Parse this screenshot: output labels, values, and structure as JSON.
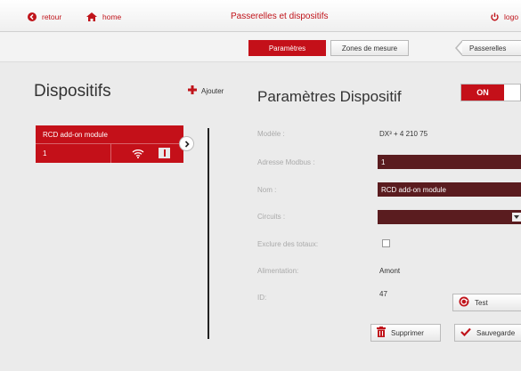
{
  "topbar": {
    "back_label": "retour",
    "home_label": "home",
    "title": "Passerelles et dispositifs",
    "logout_label": "logo"
  },
  "tabs": {
    "active": "Paramètres",
    "zones": "Zones de mesure",
    "passerelles": "Passerelles"
  },
  "left": {
    "title": "Dispositifs",
    "add_label": "Ajouter",
    "device": {
      "name": "RCD add-on module",
      "number": "1"
    }
  },
  "form": {
    "title": "Paramètres Dispositif",
    "toggle_label": "ON",
    "model_label": "Modèle :",
    "model_value": "DX³ + 4 210 75",
    "modbus_label": "Adresse Modbus :",
    "modbus_value": "1",
    "name_label": "Nom :",
    "name_value": "RCD add-on module",
    "circuits_label": "Circuits :",
    "circuits_value": "",
    "exclude_label": "Exclure des totaux:",
    "exclude_checked": false,
    "power_label": "Alimentation:",
    "power_value": "Amont",
    "id_label": "ID:",
    "id_value": "47",
    "test_label": "Test",
    "delete_label": "Supprimer",
    "save_label": "Sauvegarde"
  },
  "colors": {
    "accent": "#c41019",
    "field_bg": "#5a1c1f",
    "label": "#aaaaaa"
  }
}
